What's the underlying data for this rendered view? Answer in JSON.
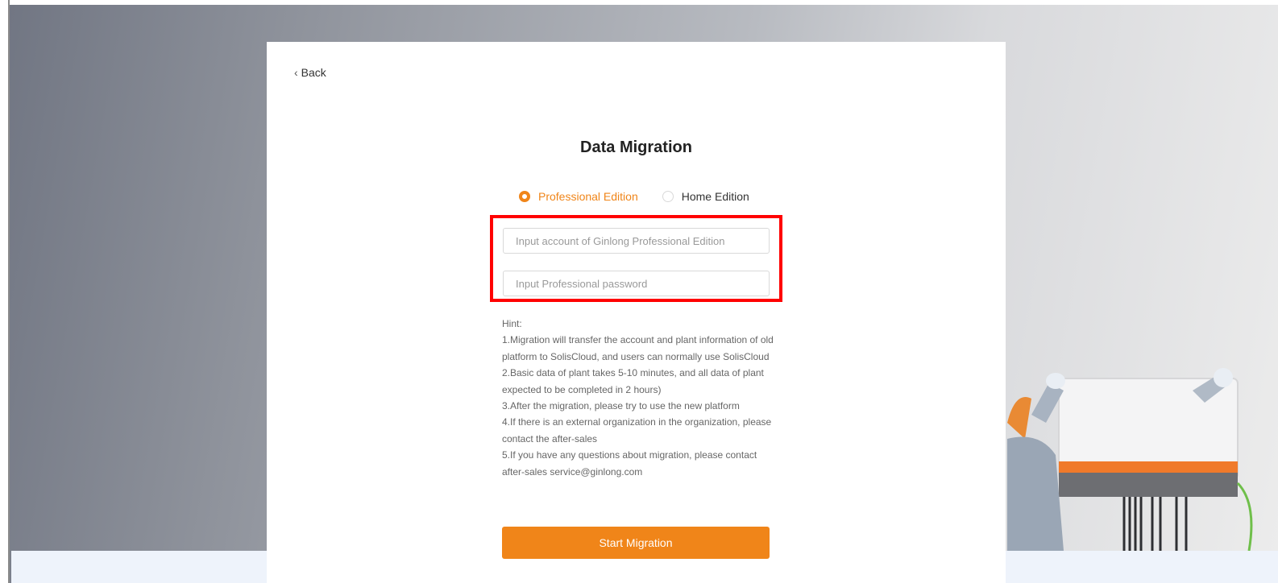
{
  "nav": {
    "back_label": "Back",
    "back_icon": "chevron-left-icon"
  },
  "page": {
    "title": "Data Migration"
  },
  "edition": {
    "options": [
      {
        "label": "Professional Edition",
        "checked": true
      },
      {
        "label": "Home Edition",
        "checked": false
      }
    ]
  },
  "form": {
    "account_placeholder": "Input account of Ginlong Professional Edition",
    "password_placeholder": "Input Professional password"
  },
  "hint": {
    "lines": [
      "Hint:",
      "1.Migration will transfer the account and plant information of old platform to SolisCloud, and users can normally use SolisCloud",
      "2.Basic data of plant takes 5-10 minutes, and all data of plant expected to be completed in 2 hours)",
      "3.After the migration, please try to use the new platform",
      "4.If there is an external organization in the organization, please contact the after-sales",
      "5.If you have any questions about migration, please contact after-sales service@ginlong.com"
    ]
  },
  "actions": {
    "start_label": "Start Migration"
  },
  "colors": {
    "accent": "#f08519",
    "highlight": "#ff0000"
  }
}
